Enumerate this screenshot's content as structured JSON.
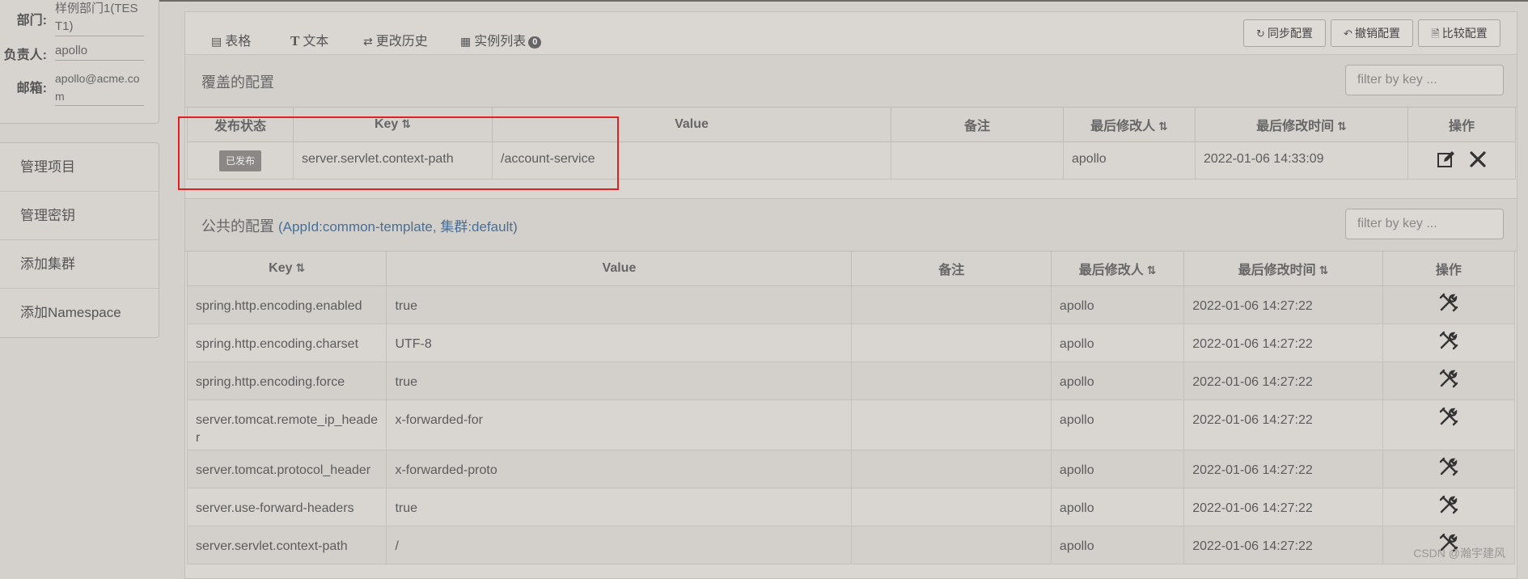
{
  "info": {
    "dept_label": "部门:",
    "dept_value": "样例部门1(TEST1)",
    "owner_label": "负责人:",
    "owner_value": "apollo",
    "email_label": "邮箱:",
    "email_value": "apollo@acme.com"
  },
  "nav": [
    "管理项目",
    "管理密钥",
    "添加集群",
    "添加Namespace"
  ],
  "tabs": [
    {
      "icon": "table-icon",
      "label": "表格"
    },
    {
      "icon": "text-icon",
      "label": "文本"
    },
    {
      "icon": "history-icon",
      "label": "更改历史"
    },
    {
      "icon": "instances-icon",
      "label": "实例列表",
      "badge": "0"
    }
  ],
  "toolbar": {
    "sync_label": "同步配置",
    "rollback_label": "撤销配置",
    "compare_label": "比较配置"
  },
  "override_section": {
    "title": "覆盖的配置",
    "filter_placeholder": "filter by key ...",
    "headers": [
      "发布状态",
      "Key",
      "Value",
      "备注",
      "最后修改人",
      "最后修改时间",
      "操作"
    ],
    "rows": [
      {
        "status": "已发布",
        "key": "server.servlet.context-path",
        "value": "/account-service",
        "comment": "",
        "modifier": "apollo",
        "time": "2022-01-06 14:33:09"
      }
    ]
  },
  "public_section": {
    "title": "公共的配置",
    "app_info": "(AppId:common-template, 集群:default)",
    "filter_placeholder": "filter by key ...",
    "headers": [
      "Key",
      "Value",
      "备注",
      "最后修改人",
      "最后修改时间",
      "操作"
    ],
    "rows": [
      {
        "key": "spring.http.encoding.enabled",
        "value": "true",
        "comment": "",
        "modifier": "apollo",
        "time": "2022-01-06 14:27:22"
      },
      {
        "key": "spring.http.encoding.charset",
        "value": "UTF-8",
        "comment": "",
        "modifier": "apollo",
        "time": "2022-01-06 14:27:22"
      },
      {
        "key": "spring.http.encoding.force",
        "value": "true",
        "comment": "",
        "modifier": "apollo",
        "time": "2022-01-06 14:27:22"
      },
      {
        "key": "server.tomcat.remote_ip_header",
        "value": "x-forwarded-for",
        "comment": "",
        "modifier": "apollo",
        "time": "2022-01-06 14:27:22"
      },
      {
        "key": "server.tomcat.protocol_header",
        "value": "x-forwarded-proto",
        "comment": "",
        "modifier": "apollo",
        "time": "2022-01-06 14:27:22"
      },
      {
        "key": "server.use-forward-headers",
        "value": "true",
        "comment": "",
        "modifier": "apollo",
        "time": "2022-01-06 14:27:22"
      },
      {
        "key": "server.servlet.context-path",
        "value": "/",
        "comment": "",
        "modifier": "apollo",
        "time": "2022-01-06 14:27:22"
      }
    ]
  },
  "sort_glyph": "⇅",
  "watermark": "CSDN @瀚宇建风",
  "colors": {
    "accent": "#2f6f8f",
    "highlight": "#e02020",
    "link": "#4a6f95"
  }
}
